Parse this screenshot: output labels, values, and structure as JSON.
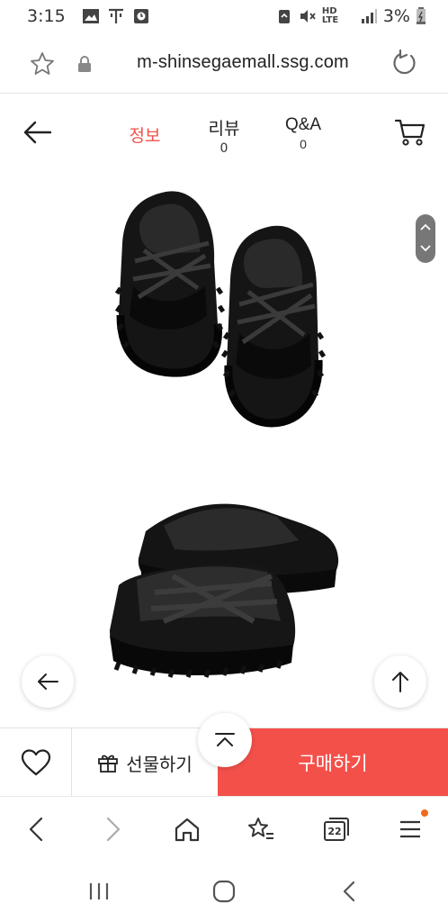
{
  "status_bar": {
    "time": "3:15",
    "battery": "3%",
    "network": "HD LTE"
  },
  "url_bar": {
    "url": "m-shinsegaemall.ssg.com"
  },
  "product_header": {
    "tabs": [
      {
        "label": "정보",
        "count": ""
      },
      {
        "label": "리뷰",
        "count": "0"
      },
      {
        "label": "Q&A",
        "count": "0"
      }
    ],
    "active_color": "#f4504a"
  },
  "buy_bar": {
    "gift_label": "선물하기",
    "buy_label": "구매하기",
    "buy_color": "#f4504a"
  },
  "browser_bar": {
    "tab_count": "22"
  },
  "icons": {
    "status": [
      "gallery-icon",
      "t-icon",
      "clock-icon",
      "recycle-icon",
      "mute-icon",
      "signal-icon",
      "battery-icon"
    ],
    "url": [
      "star-icon",
      "lock-icon",
      "reload-icon"
    ],
    "header": [
      "back-arrow-icon",
      "cart-icon"
    ],
    "toolbar": [
      "chevron-left-icon",
      "chevron-right-icon",
      "home-icon",
      "star-list-icon",
      "tabs-icon",
      "menu-icon"
    ],
    "system": [
      "recent-apps-icon",
      "home-circle-icon",
      "back-icon"
    ]
  }
}
